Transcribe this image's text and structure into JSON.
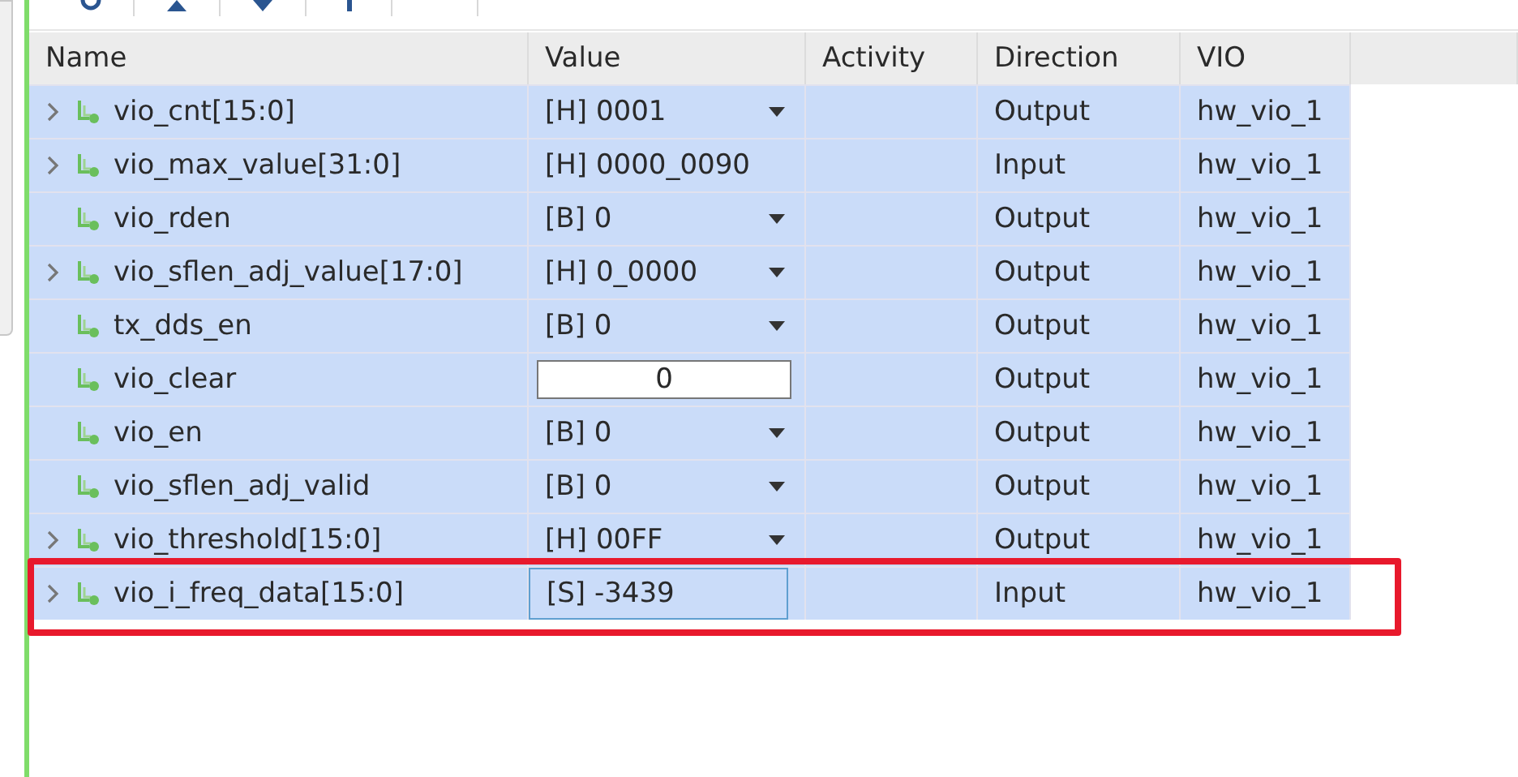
{
  "columns": [
    "Name",
    "Value",
    "Activity",
    "Direction",
    "VIO"
  ],
  "rows": [
    {
      "name": "vio_cnt[15:0]",
      "expandable": true,
      "value": "[H] 0001",
      "kind": "dropdown",
      "direction": "Output",
      "vio": "hw_vio_1",
      "highlighted": false
    },
    {
      "name": "vio_max_value[31:0]",
      "expandable": true,
      "value": "[H] 0000_0090",
      "kind": "text",
      "direction": "Input",
      "vio": "hw_vio_1",
      "highlighted": false
    },
    {
      "name": "vio_rden",
      "expandable": false,
      "value": "[B] 0",
      "kind": "dropdown",
      "direction": "Output",
      "vio": "hw_vio_1",
      "highlighted": false
    },
    {
      "name": "vio_sflen_adj_value[17:0]",
      "expandable": true,
      "value": "[H] 0_0000",
      "kind": "dropdown",
      "direction": "Output",
      "vio": "hw_vio_1",
      "highlighted": false
    },
    {
      "name": "tx_dds_en",
      "expandable": false,
      "value": "[B] 0",
      "kind": "dropdown",
      "direction": "Output",
      "vio": "hw_vio_1",
      "highlighted": false
    },
    {
      "name": "vio_clear",
      "expandable": false,
      "value": "0",
      "kind": "input",
      "direction": "Output",
      "vio": "hw_vio_1",
      "highlighted": false
    },
    {
      "name": "vio_en",
      "expandable": false,
      "value": "[B] 0",
      "kind": "dropdown",
      "direction": "Output",
      "vio": "hw_vio_1",
      "highlighted": false
    },
    {
      "name": "vio_sflen_adj_valid",
      "expandable": false,
      "value": "[B] 0",
      "kind": "dropdown",
      "direction": "Output",
      "vio": "hw_vio_1",
      "highlighted": false
    },
    {
      "name": "vio_threshold[15:0]",
      "expandable": true,
      "value": "[H] 00FF",
      "kind": "dropdown",
      "direction": "Output",
      "vio": "hw_vio_1",
      "highlighted": false
    },
    {
      "name": "vio_i_freq_data[15:0]",
      "expandable": true,
      "value": "[S] -3439",
      "kind": "focused",
      "direction": "Input",
      "vio": "hw_vio_1",
      "highlighted": true
    }
  ]
}
